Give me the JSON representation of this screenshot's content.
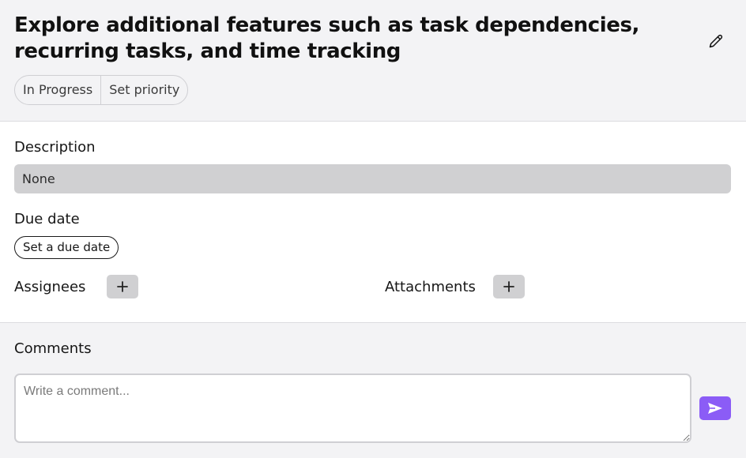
{
  "task": {
    "title": "Explore additional features such as task dependencies, recurring tasks, and time tracking",
    "status_label": "In Progress",
    "priority_label": "Set priority"
  },
  "description": {
    "label": "Description",
    "value": "None"
  },
  "due_date": {
    "label": "Due date",
    "button_label": "Set a due date"
  },
  "assignees": {
    "label": "Assignees",
    "add_icon": "plus-icon"
  },
  "attachments": {
    "label": "Attachments",
    "add_icon": "plus-icon"
  },
  "comments": {
    "label": "Comments",
    "placeholder": "Write a comment...",
    "send_icon": "send-icon"
  },
  "colors": {
    "accent": "#8b5cf6",
    "header_bg": "#f3f3f5",
    "field_bg": "#d0d0d2"
  }
}
